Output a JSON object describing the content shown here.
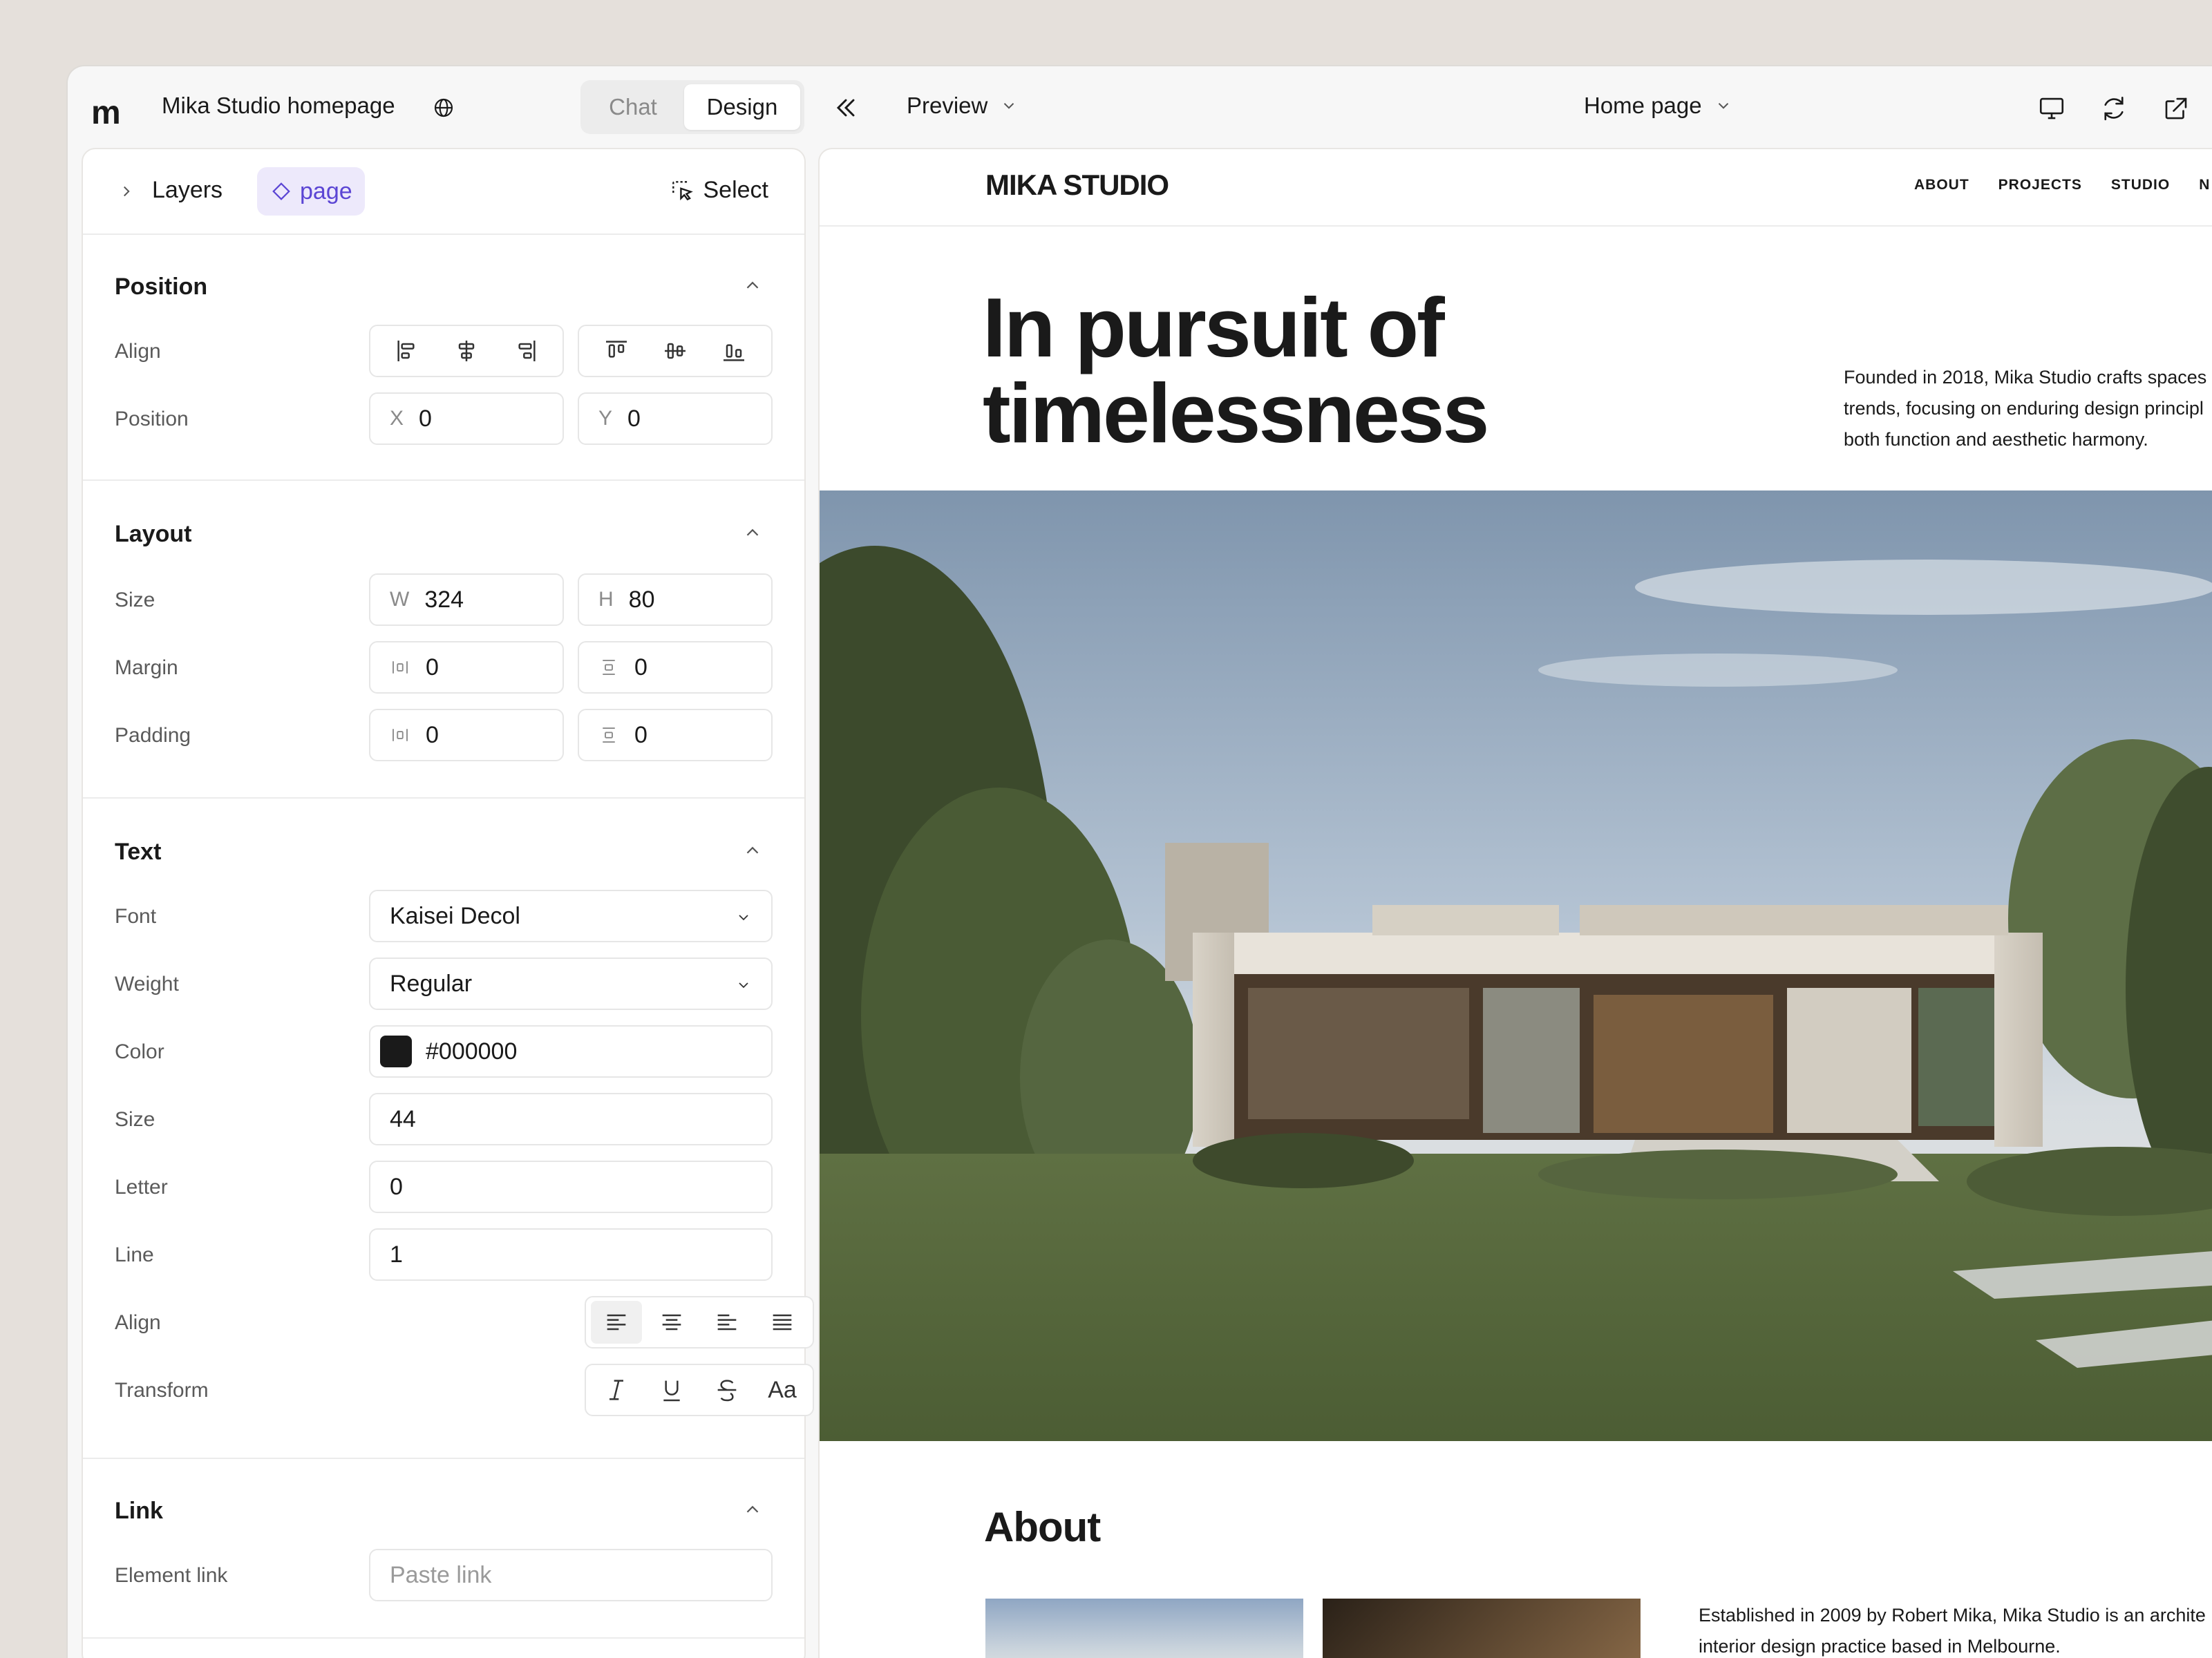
{
  "app": {
    "logo": "m",
    "project_title": "Mika Studio homepage",
    "modes": {
      "chat": "Chat",
      "design": "Design"
    },
    "preview_label": "Preview",
    "page_selector": "Home page"
  },
  "panel": {
    "layers_label": "Layers",
    "page_chip": "page",
    "select_label": "Select",
    "position": {
      "title": "Position",
      "align_label": "Align",
      "position_label": "Position",
      "x_prefix": "X",
      "x_value": "0",
      "y_prefix": "Y",
      "y_value": "0"
    },
    "layout": {
      "title": "Layout",
      "size_label": "Size",
      "w_prefix": "W",
      "w_value": "324",
      "h_prefix": "H",
      "h_value": "80",
      "margin_label": "Margin",
      "margin_h": "0",
      "margin_v": "0",
      "padding_label": "Padding",
      "padding_h": "0",
      "padding_v": "0"
    },
    "text": {
      "title": "Text",
      "font_label": "Font",
      "font_value": "Kaisei Decol",
      "weight_label": "Weight",
      "weight_value": "Regular",
      "color_label": "Color",
      "color_value": "#000000",
      "size_label": "Size",
      "size_value": "44",
      "letter_label": "Letter",
      "letter_value": "0",
      "line_label": "Line",
      "line_value": "1",
      "align_label": "Align",
      "transform_label": "Transform",
      "case_glyph": "Aa"
    },
    "link": {
      "title": "Link",
      "element_link_label": "Element link",
      "placeholder": "Paste link"
    }
  },
  "site": {
    "logo": "MIKA STUDIO",
    "nav": [
      "ABOUT",
      "PROJECTS",
      "STUDIO",
      "N"
    ],
    "hero_title_1": "In pursuit of",
    "hero_title_2": "timelessness",
    "hero_desc_1": "Founded in 2018, Mika Studio crafts spaces",
    "hero_desc_2": "trends, focusing on enduring design principl",
    "hero_desc_3": "both function and aesthetic harmony.",
    "about_title": "About",
    "about_desc_1": "Established in 2009 by Robert Mika, Mika Studio is an archite",
    "about_desc_2": "interior design practice based in Melbourne."
  }
}
